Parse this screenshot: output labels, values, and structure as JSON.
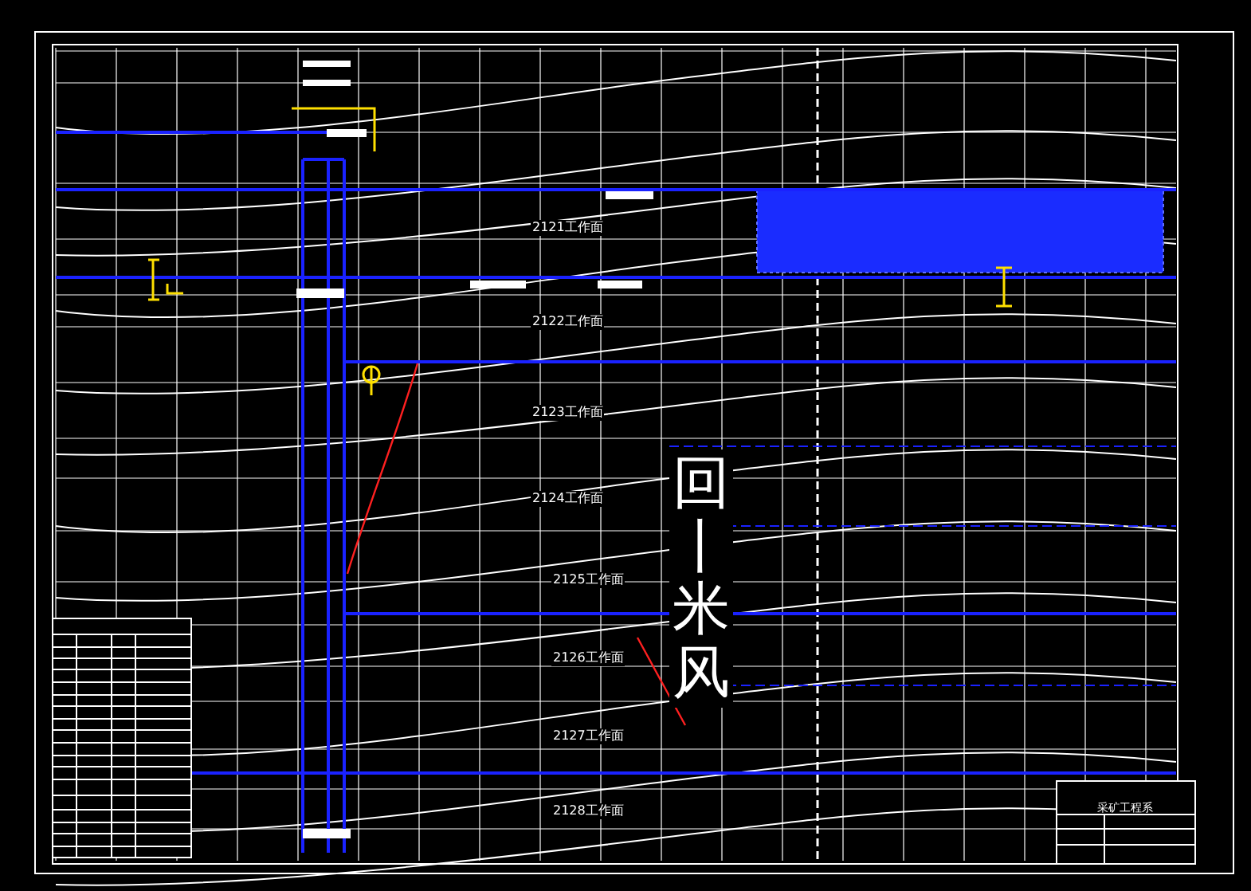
{
  "workfaces": [
    {
      "label": "2121工作面"
    },
    {
      "label": "2122工作面"
    },
    {
      "label": "2123工作面"
    },
    {
      "label": "2124工作面"
    },
    {
      "label": "2125工作面"
    },
    {
      "label": "2126工作面"
    },
    {
      "label": "2127工作面"
    },
    {
      "label": "2128工作面"
    }
  ],
  "annotation": "回丨米风",
  "title_block": {
    "title": "采矿工程系"
  }
}
